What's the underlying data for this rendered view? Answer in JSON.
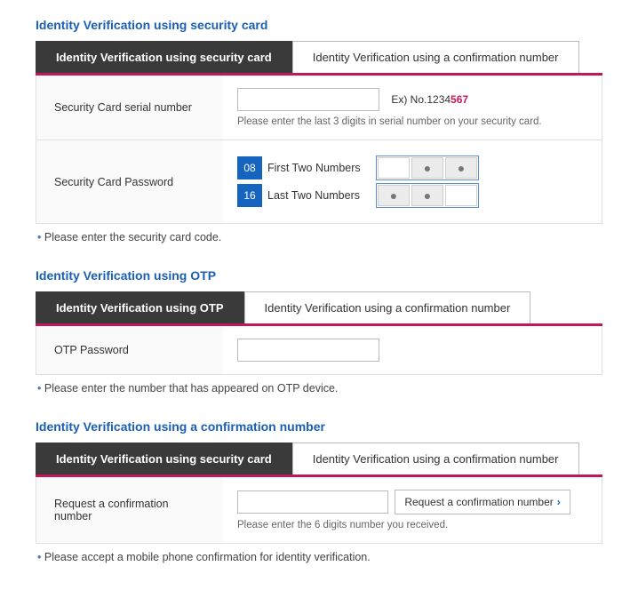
{
  "sec1": {
    "title": "Identity Verification using security card",
    "tab_active": "Identity Verification using security card",
    "tab_inactive": "Identity Verification using a confirmation number",
    "row_serial_label": "Security Card serial number",
    "serial_example_prefix": "Ex) No.1234",
    "serial_example_suffix": "567",
    "serial_hint": "Please enter the last 3 digits in serial number on your security card.",
    "row_pw_label": "Security Card Password",
    "pw_badge_1": "08",
    "pw_desc_1": "First Two Numbers",
    "pw_badge_2": "16",
    "pw_desc_2": "Last Two Numbers",
    "note": "Please enter the security card code."
  },
  "sec2": {
    "title": "Identity Verification using OTP",
    "tab_active": "Identity Verification using OTP",
    "tab_inactive": "Identity Verification using a confirmation number",
    "row_label": "OTP Password",
    "note": "Please enter the number that has appeared on OTP device."
  },
  "sec3": {
    "title": "Identity Verification using a confirmation number",
    "tab_left": "Identity Verification using security card",
    "tab_right": "Identity Verification using a confirmation number",
    "row_label": "Request a confirmation number",
    "btn_label": "Request a confirmation number",
    "hint": "Please enter the 6 digits number you received.",
    "note": "Please accept a mobile phone confirmation for identity verification."
  }
}
